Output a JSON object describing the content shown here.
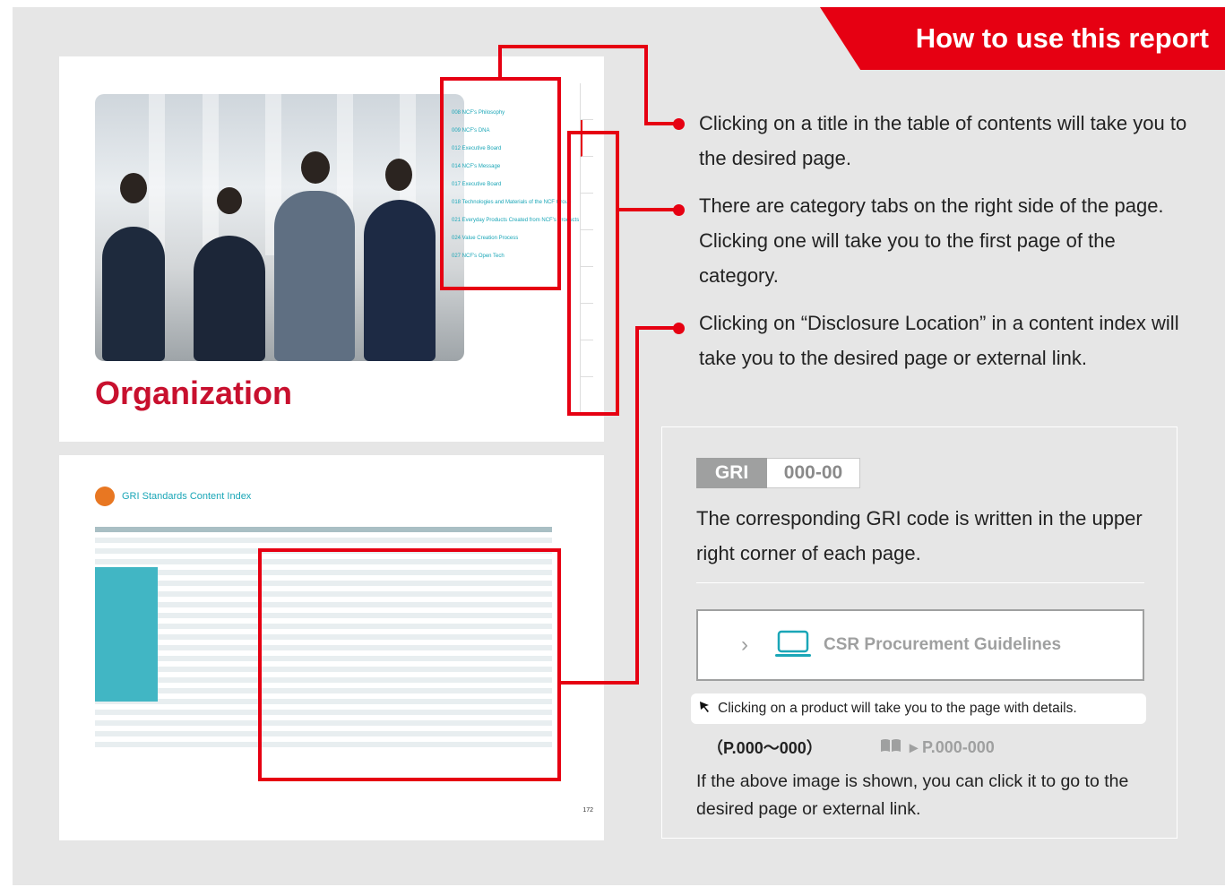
{
  "banner": {
    "title": "How to use this report"
  },
  "thumbnail_1": {
    "title": "Organization",
    "toc_items": [
      "008 NCF's Philosophy",
      "009 NCF's DNA",
      "012 Executive Board",
      "014 NCF's Message",
      "017 Executive Board",
      "018 Technologies and Materials of the NCF Group",
      "021 Everyday Products Created from NCF's Products",
      "024 Value Creation Process",
      "027 NCF's Open Tech"
    ]
  },
  "thumbnail_2": {
    "header": "GRI Standards Content Index",
    "page_number": "172"
  },
  "descriptions": [
    {
      "text": "Clicking on a title in the table of contents will take you to the desired page."
    },
    {
      "text": "There are category tabs on the right side of the page. Clicking one will take you to the first page of the category."
    },
    {
      "text": "Clicking on “Disclosure Location” in a content index will take you to the desired page or external link."
    }
  ],
  "info_box": {
    "gri_label": "GRI",
    "gri_code": "000-00",
    "gri_text": "The corresponding GRI code is written in the upper right corner of each page.",
    "csr_button_label": "CSR Procurement Guidelines",
    "click_note": "Clicking on a product will take you to the page with details.",
    "page_ref": "（P.000〜000）",
    "page_ref_2": "▸ P.000-000",
    "bottom_text": "If the above image is shown, you can click it to go to the desired page or external link."
  },
  "colors": {
    "accent": "#e60012",
    "teal": "#1aa6b7",
    "gray": "#9fa0a0",
    "background": "#e6e6e6"
  }
}
